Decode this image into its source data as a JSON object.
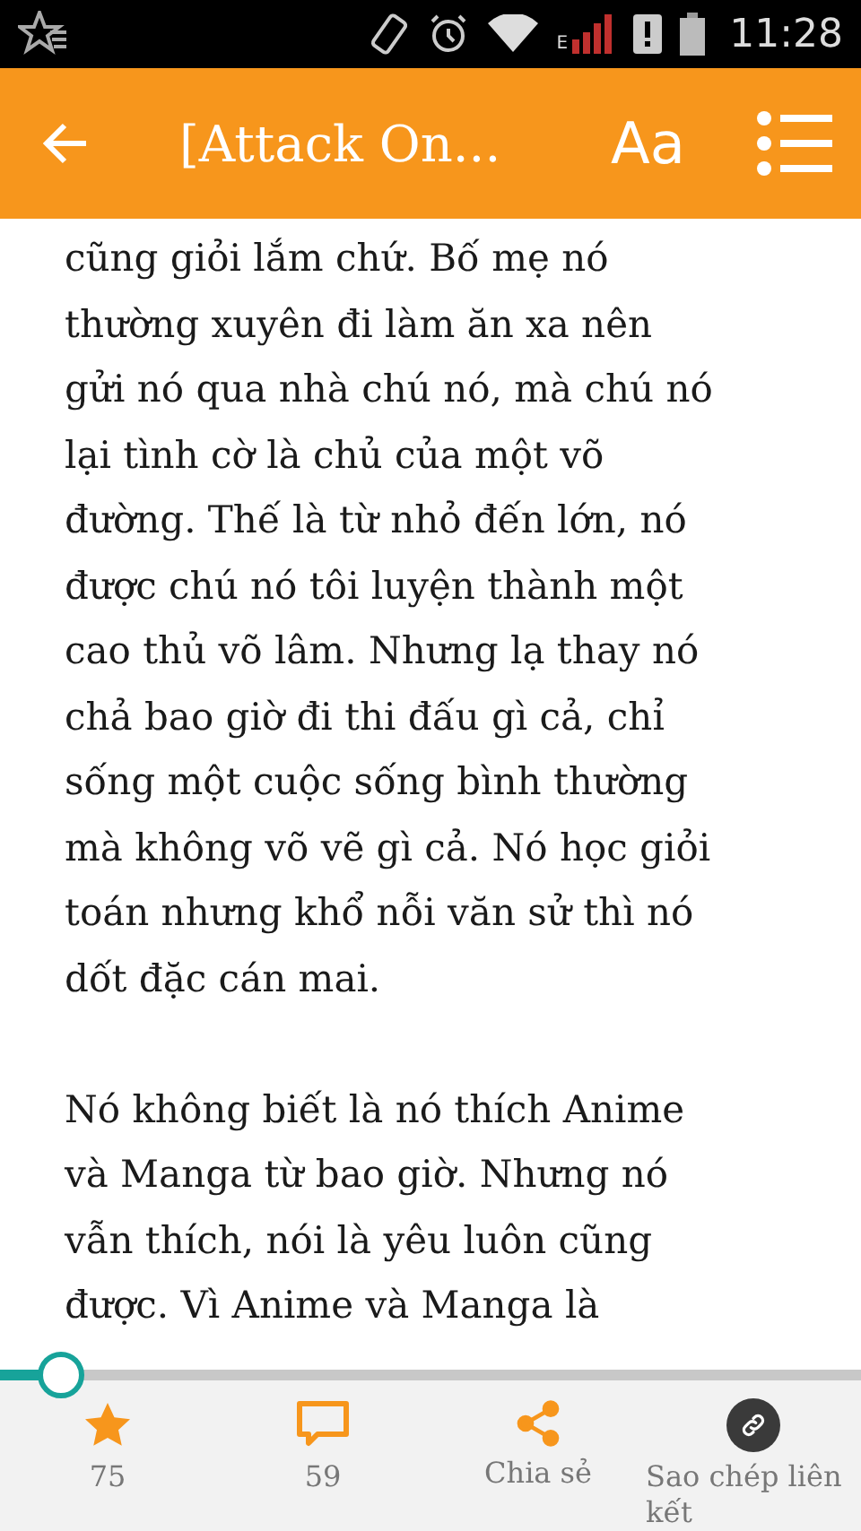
{
  "status_bar": {
    "network": "E",
    "time": "11:28"
  },
  "toolbar": {
    "title": "[Attack On...",
    "font_button": "Aa"
  },
  "paragraphs": [
    {
      "lines": [
        "cũng giỏi lắm chứ. Bố mẹ nó",
        "thường xuyên đi làm ăn xa nên",
        "gửi nó qua nhà chú nó, mà chú nó",
        "lại tình cờ là chủ của một võ",
        "đường. Thế là từ nhỏ đến lớn, nó",
        "được chú nó tôi luyện thành một",
        "cao thủ võ lâm. Nhưng lạ thay nó",
        "chả bao giờ đi thi đấu gì cả, chỉ",
        "sống một cuộc sống bình thường",
        "mà không võ vẽ gì cả. Nó học giỏi",
        "toán nhưng khổ nỗi văn sử thì nó",
        "dốt đặc cán mai."
      ]
    },
    {
      "lines": [
        "Nó không biết là nó thích Anime",
        "và Manga từ bao giờ. Nhưng nó",
        "vẫn thích, nói là yêu luôn cũng",
        "được. Vì Anime và Manga là"
      ]
    }
  ],
  "progress": {
    "level": 0.07
  },
  "actions": [
    {
      "kind": "star",
      "label": "75"
    },
    {
      "kind": "comment",
      "label": "59"
    },
    {
      "kind": "share",
      "label": "Chia sẻ"
    },
    {
      "kind": "link",
      "label": "Sao chép liên kết"
    }
  ]
}
